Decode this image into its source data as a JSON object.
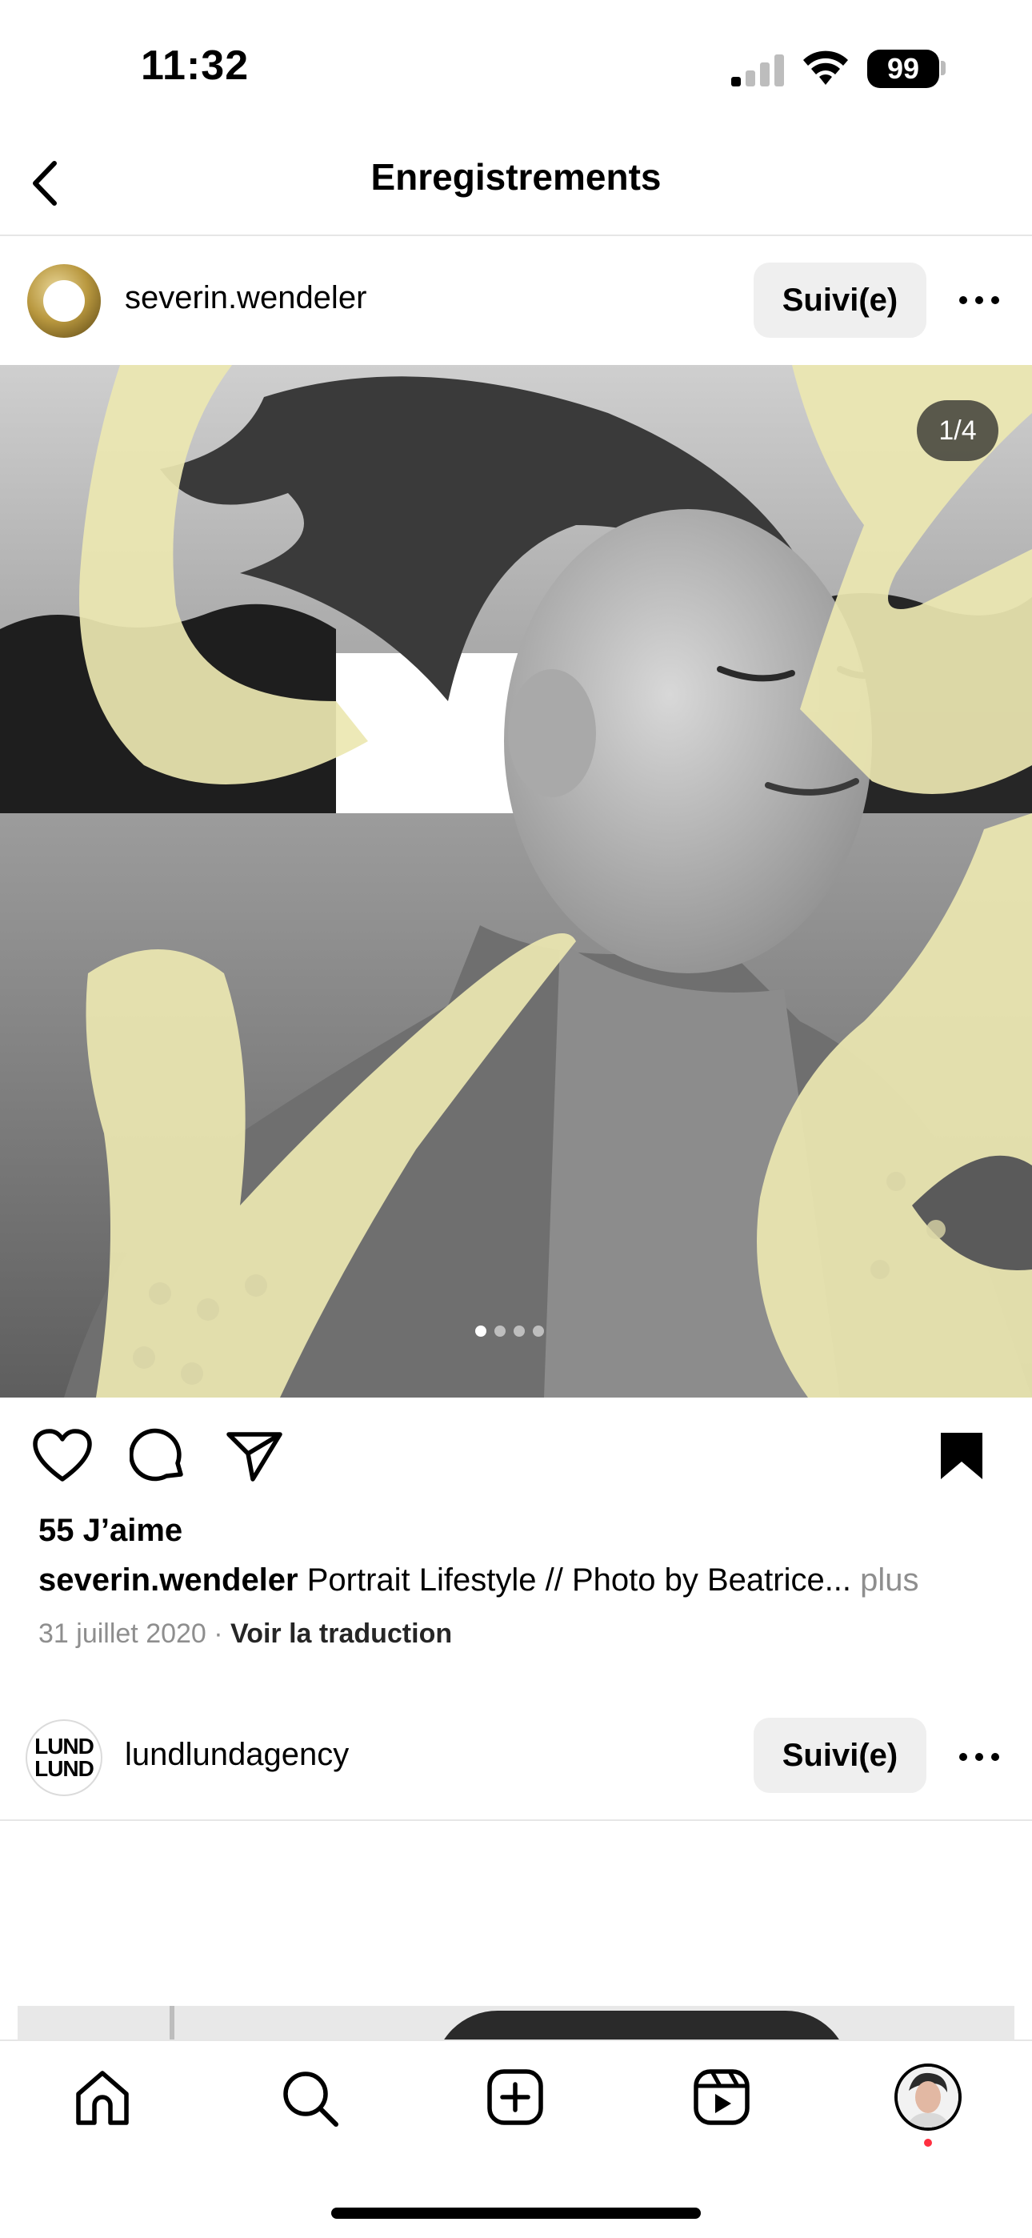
{
  "status_bar": {
    "time": "11:32",
    "battery": "99"
  },
  "header": {
    "title": "Enregistrements",
    "back_icon": "chevron-left-icon"
  },
  "post1": {
    "username": "severin.wendeler",
    "follow_label": "Suivi(e)",
    "more_icon": "ellipsis-icon",
    "media_counter": "1/4",
    "carousel_count": 4,
    "carousel_active": 0,
    "likes": "55 J’aime",
    "caption_user": "severin.wendeler",
    "caption_text": " Portrait Lifestyle // Photo by Beatrice...",
    "caption_more": " plus",
    "date": "31 juillet 2020",
    "separator": " · ",
    "translate_label": "Voir la traduction",
    "bookmark_saved": true
  },
  "post2": {
    "username": "lundlundagency",
    "avatar_text_line1": "LUND",
    "avatar_text_line2": "LUND",
    "follow_label": "Suivi(e)"
  },
  "colors": {
    "accent_yellow": "#ece7b1",
    "button_bg": "#efefef",
    "muted_text": "#8e8e8e",
    "notification_dot": "#ff3040"
  },
  "tab_bar": {
    "items": [
      "home-icon",
      "search-icon",
      "create-icon",
      "reels-icon",
      "profile-avatar"
    ]
  }
}
